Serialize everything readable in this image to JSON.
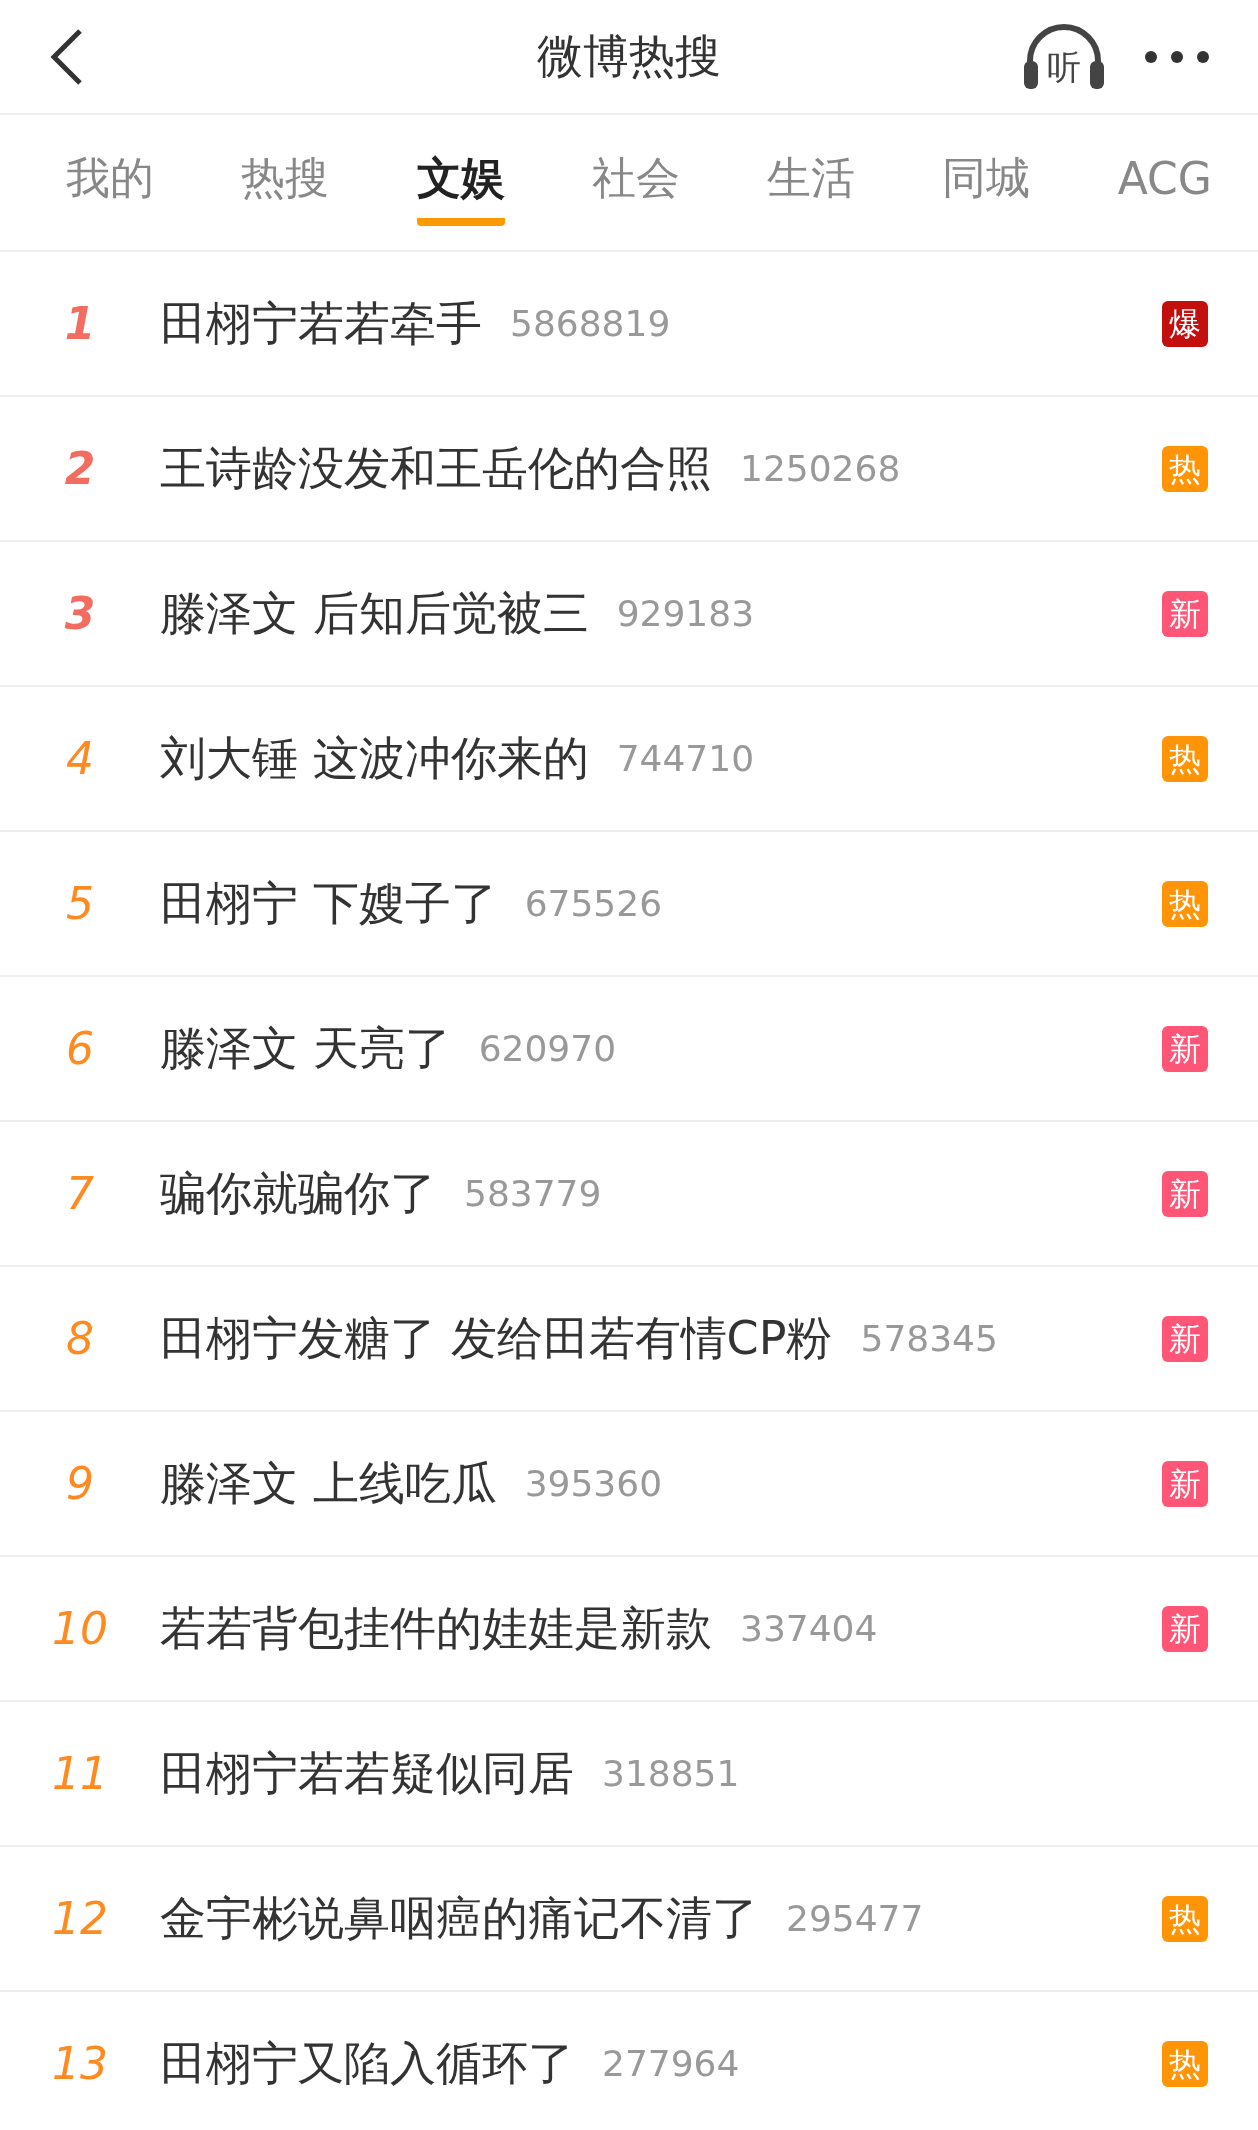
{
  "header": {
    "title": "微博热搜",
    "listen_label": "听"
  },
  "tabs": [
    {
      "label": "我的",
      "selected": false
    },
    {
      "label": "热搜",
      "selected": false
    },
    {
      "label": "文娱",
      "selected": true
    },
    {
      "label": "社会",
      "selected": false
    },
    {
      "label": "生活",
      "selected": false
    },
    {
      "label": "同城",
      "selected": false
    },
    {
      "label": "ACG",
      "selected": false
    }
  ],
  "items": [
    {
      "rank": "1",
      "top": true,
      "title": "田栩宁若若牵手",
      "count": "5868819",
      "badge": {
        "kind": "explode",
        "text": "爆"
      }
    },
    {
      "rank": "2",
      "top": true,
      "title": "王诗龄没发和王岳伦的合照",
      "count": "1250268",
      "badge": {
        "kind": "hot",
        "text": "热"
      }
    },
    {
      "rank": "3",
      "top": true,
      "title": "滕泽文 后知后觉被三",
      "count": "929183",
      "badge": {
        "kind": "new",
        "text": "新"
      }
    },
    {
      "rank": "4",
      "top": false,
      "title": "刘大锤 这波冲你来的",
      "count": "744710",
      "badge": {
        "kind": "hot",
        "text": "热"
      }
    },
    {
      "rank": "5",
      "top": false,
      "title": "田栩宁 下嫂子了",
      "count": "675526",
      "badge": {
        "kind": "hot",
        "text": "热"
      }
    },
    {
      "rank": "6",
      "top": false,
      "title": "滕泽文 天亮了",
      "count": "620970",
      "badge": {
        "kind": "new",
        "text": "新"
      }
    },
    {
      "rank": "7",
      "top": false,
      "title": "骗你就骗你了",
      "count": "583779",
      "badge": {
        "kind": "new",
        "text": "新"
      }
    },
    {
      "rank": "8",
      "top": false,
      "title": "田栩宁发糖了 发给田若有情CP粉",
      "count": "578345",
      "badge": {
        "kind": "new",
        "text": "新"
      }
    },
    {
      "rank": "9",
      "top": false,
      "title": "滕泽文 上线吃瓜",
      "count": "395360",
      "badge": {
        "kind": "new",
        "text": "新"
      }
    },
    {
      "rank": "10",
      "top": false,
      "title": "若若背包挂件的娃娃是新款",
      "count": "337404",
      "badge": {
        "kind": "new",
        "text": "新"
      }
    },
    {
      "rank": "11",
      "top": false,
      "title": "田栩宁若若疑似同居",
      "count": "318851"
    },
    {
      "rank": "12",
      "top": false,
      "title": "金宇彬说鼻咽癌的痛记不清了",
      "count": "295477",
      "badge": {
        "kind": "hot",
        "text": "热"
      }
    },
    {
      "rank": "13",
      "top": false,
      "title": "田栩宁又陷入循环了",
      "count": "277964",
      "badge": {
        "kind": "hot",
        "text": "热"
      }
    }
  ]
}
